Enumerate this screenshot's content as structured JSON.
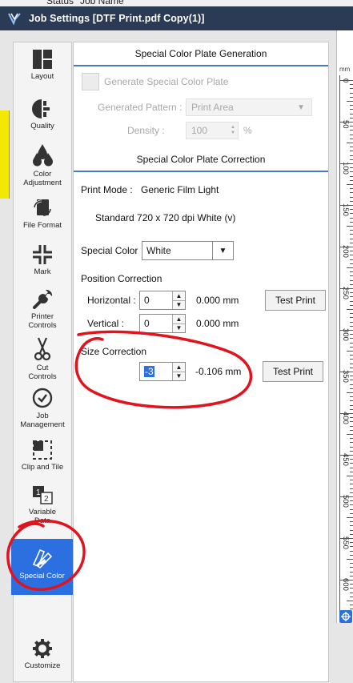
{
  "background": {
    "col1": "Status",
    "col2": "Job Name"
  },
  "window": {
    "title": "Job Settings [DTF Print.pdf Copy(1)]"
  },
  "sidebar": {
    "items": [
      {
        "label": "Layout"
      },
      {
        "label": "Quality"
      },
      {
        "label": "Color Adjustment"
      },
      {
        "label": "File Format"
      },
      {
        "label": "Mark"
      },
      {
        "label": "Printer Controls"
      },
      {
        "label": "Cut Controls"
      },
      {
        "label": "Job Management"
      },
      {
        "label": "Clip and Tile"
      },
      {
        "label": "Variable Data"
      },
      {
        "label": "Special Color"
      },
      {
        "label": "Customize"
      }
    ]
  },
  "plate_generation": {
    "header": "Special Color Plate Generation",
    "checkbox_label": "Generate Special Color Plate",
    "pattern_label": "Generated Pattern :",
    "pattern_value": "Print Area",
    "density_label": "Density :",
    "density_value": "100",
    "density_unit": "%"
  },
  "plate_correction": {
    "header": "Special Color Plate Correction",
    "print_mode_label": "Print Mode :",
    "print_mode_value": "Generic Film Light",
    "resolution": "Standard 720 x 720 dpi White (v)",
    "special_color_label": "Special Color",
    "special_color_value": "White",
    "position_label": "Position Correction",
    "horizontal_label": "Horizontal :",
    "horizontal_value": "0",
    "horizontal_mm": "0.000 mm",
    "vertical_label": "Vertical :",
    "vertical_value": "0",
    "vertical_mm": "0.000 mm",
    "size_label": "Size Correction",
    "size_value": "-3",
    "size_mm": "-0.106 mm",
    "test_print_label": "Test Print"
  },
  "ruler": {
    "unit": "mm",
    "ticks": [
      "0",
      "50",
      "100",
      "150",
      "200",
      "250",
      "300",
      "350",
      "400",
      "450",
      "500",
      "550",
      "600"
    ]
  },
  "colors": {
    "accent": "#2c6fe0",
    "titlebar": "#2b3b55",
    "annotation": "#e0141e"
  }
}
